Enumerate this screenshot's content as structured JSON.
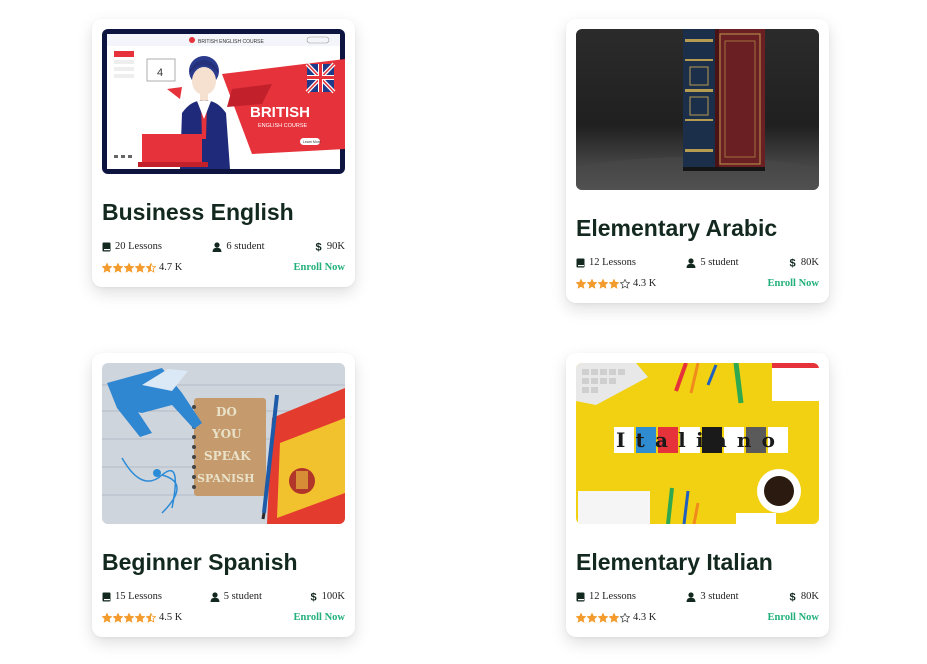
{
  "colors": {
    "accent": "#21b07a",
    "title": "#13291f",
    "star": "#f39c2d"
  },
  "courses": [
    {
      "title": "Business English",
      "lessons": "20 Lessons",
      "students": "6 student",
      "price": "90K",
      "rating": "4.7 K",
      "stars": 4.5,
      "enroll": "Enroll Now",
      "image": {
        "alt": "British English course illustration",
        "brand": "BRITISH ENGLISH COURSE",
        "headline": "BRITISH",
        "subline": "ENGLISH COURSE",
        "badge": "4",
        "button": "Learn More"
      }
    },
    {
      "title": "Elementary Arabic",
      "lessons": "12 Lessons",
      "students": "5 student",
      "price": "80K",
      "rating": "4.3 K",
      "stars": 4,
      "enroll": "Enroll Now",
      "image": {
        "alt": "Antique books on dark background"
      }
    },
    {
      "title": "Beginner Spanish",
      "lessons": "15 Lessons",
      "students": "5 student",
      "price": "100K",
      "rating": "4.5 K",
      "stars": 4.5,
      "enroll": "Enroll Now",
      "image": {
        "alt": "Notebook with Do you speak Spanish letters",
        "line1": "DO",
        "line2": "YOU",
        "line3": "SPEAK",
        "line4": "SPANISH"
      }
    },
    {
      "title": "Elementary Italian",
      "lessons": "12 Lessons",
      "students": "3 student",
      "price": "80K",
      "rating": "4.3 K",
      "stars": 4,
      "enroll": "Enroll Now",
      "image": {
        "alt": "Italiano letters on yellow desk",
        "word": "Italiano"
      }
    }
  ]
}
